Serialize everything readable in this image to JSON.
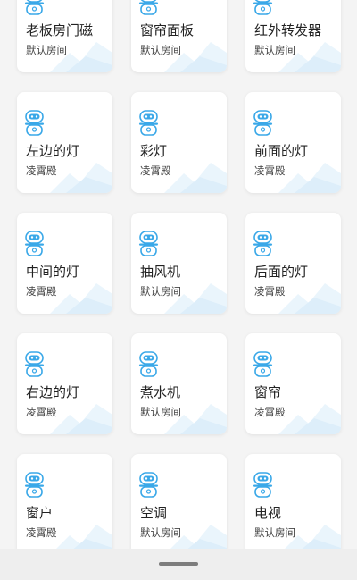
{
  "devices": [
    {
      "name": "老板房门磁",
      "room": "默认房间"
    },
    {
      "name": "窗帘面板",
      "room": "默认房间"
    },
    {
      "name": "红外转发器",
      "room": "默认房间"
    },
    {
      "name": "左边的灯",
      "room": "凌霄殿"
    },
    {
      "name": "彩灯",
      "room": "凌霄殿"
    },
    {
      "name": "前面的灯",
      "room": "凌霄殿"
    },
    {
      "name": "中间的灯",
      "room": "凌霄殿"
    },
    {
      "name": "抽风机",
      "room": "默认房间"
    },
    {
      "name": "后面的灯",
      "room": "凌霄殿"
    },
    {
      "name": "右边的灯",
      "room": "凌霄殿"
    },
    {
      "name": "煮水机",
      "room": "默认房间"
    },
    {
      "name": "窗帘",
      "room": "凌霄殿"
    },
    {
      "name": "窗户",
      "room": "凌霄殿"
    },
    {
      "name": "空调",
      "room": "默认房间"
    },
    {
      "name": "电视",
      "room": "默认房间"
    }
  ],
  "icons": {
    "device": "robot-icon"
  },
  "colors": {
    "icon_accent": "#3aa8e8",
    "background": "#f4f4f4",
    "card": "#ffffff"
  }
}
